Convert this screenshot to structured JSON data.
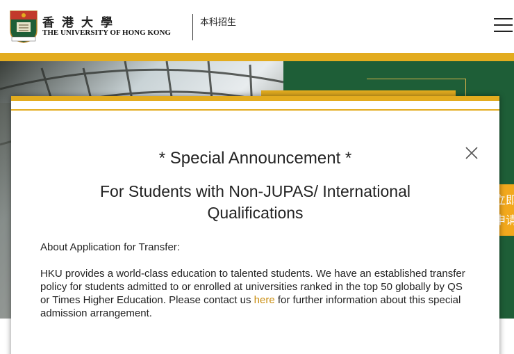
{
  "header": {
    "logo_name_cn": "香港大學",
    "logo_name_en": "THE UNIVERSITY OF HONG KONG",
    "section_title": "本科招生",
    "menu_icon": "hamburger-icon"
  },
  "hero": {
    "apply_button_label": "立即申请"
  },
  "modal": {
    "title": "* Special Announcement *",
    "subtitle": "For Students with Non-JUPAS/ International Qualifications",
    "heading": "About Application for Transfer:",
    "body_before_link": "HKU provides a world-class education to talented students. We have an established transfer policy for students admitted to or enrolled at universities ranked in the top 50 globally by QS or Times Higher Education. Please contact us ",
    "link_text": "here",
    "body_after_link": " for further information about this special admission arrangement.",
    "close_icon": "close-icon"
  },
  "colors": {
    "brand_green": "#1e5e37",
    "brand_gold": "#e3ac1f",
    "apply_orange": "#f2a81d",
    "link_color": "#c98d10"
  }
}
